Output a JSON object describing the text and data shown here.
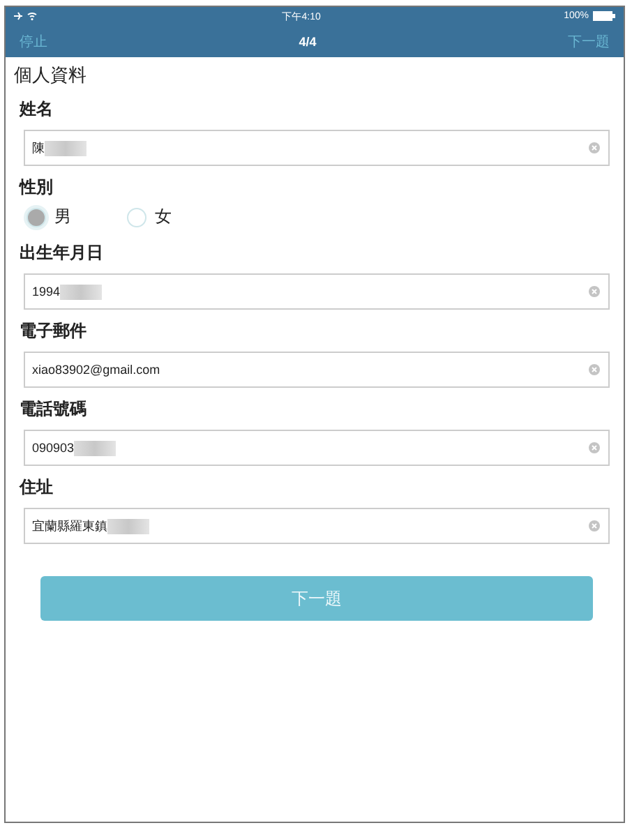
{
  "status_bar": {
    "time": "下午4:10",
    "battery": "100%"
  },
  "nav": {
    "left": "停止",
    "title": "4/4",
    "right": "下一題"
  },
  "section_title": "個人資料",
  "questions": [
    {
      "kind": "text",
      "label": "姓名",
      "value": "陳",
      "redacted": true
    },
    {
      "kind": "radio",
      "label": "性別",
      "options": [
        {
          "label": "男",
          "selected": true
        },
        {
          "label": "女",
          "selected": false
        }
      ]
    },
    {
      "kind": "text",
      "label": "出生年月日",
      "value": "1994",
      "redacted": true
    },
    {
      "kind": "text",
      "label": "電子郵件",
      "value": "xiao83902@gmail.com",
      "redacted": false
    },
    {
      "kind": "text",
      "label": "電話號碼",
      "value": "090903",
      "redacted": true
    },
    {
      "kind": "text",
      "label": "住址",
      "value": "宜蘭縣羅東鎮",
      "redacted": true
    }
  ],
  "next_button": "下一題"
}
